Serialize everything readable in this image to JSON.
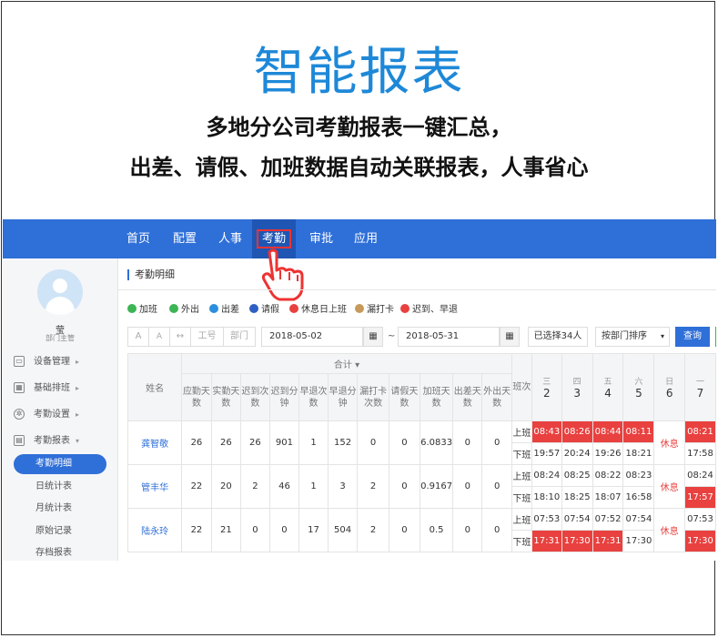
{
  "hero": {
    "title": "智能报表",
    "line1": "多地分公司考勤报表一键汇总，",
    "line2": "出差、请假、加班数据自动关联报表，人事省心"
  },
  "colors": {
    "primary": "#2f6fd8",
    "late": "#e8413f",
    "accent": "#1e88d8"
  },
  "nav": {
    "items": [
      {
        "label": "首页",
        "active": false
      },
      {
        "label": "配置",
        "active": false
      },
      {
        "label": "人事",
        "active": false
      },
      {
        "label": "考勤",
        "active": true
      },
      {
        "label": "审批",
        "active": false
      },
      {
        "label": "应用",
        "active": false
      }
    ]
  },
  "user": {
    "name": "莹",
    "role": "部门主管"
  },
  "sidebar": {
    "menu": [
      {
        "label": "设备管理",
        "icon": "device-icon"
      },
      {
        "label": "基础排班",
        "icon": "calendar-icon"
      },
      {
        "label": "考勤设置",
        "icon": "gear-icon"
      },
      {
        "label": "考勤报表",
        "icon": "report-icon"
      }
    ],
    "submenu": [
      {
        "label": "考勤明细",
        "active": true
      },
      {
        "label": "日统计表",
        "active": false
      },
      {
        "label": "月统计表",
        "active": false
      },
      {
        "label": "原始记录",
        "active": false
      },
      {
        "label": "存档报表",
        "active": false
      }
    ]
  },
  "page": {
    "breadcrumb": "考勤明细",
    "legend": [
      {
        "label": "加班",
        "color": "#3cb554"
      },
      {
        "label": "外出",
        "color": "#3cb554"
      },
      {
        "label": "出差",
        "color": "#2b8fe0"
      },
      {
        "label": "请假",
        "color": "#2f5fc4"
      },
      {
        "label": "休息日上班",
        "color": "#e8413f"
      },
      {
        "label": "漏打卡",
        "color": "#c79a5a"
      },
      {
        "label": "迟到、早退",
        "color": "#e8413f"
      }
    ],
    "toolbar": {
      "font_a1": "A",
      "font_a2": "A",
      "arrows": "↔",
      "employee_no": "工号",
      "department": "部门",
      "start_date": "2018-05-02",
      "tilde": "~",
      "end_date": "2018-05-31",
      "selected": "已选择34人",
      "sort": "按部门排序",
      "query": "查询"
    }
  },
  "table": {
    "name_header": "姓名",
    "total_header": "合计",
    "stat_headers": [
      "应勤天数",
      "实勤天数",
      "迟到次数",
      "迟到分钟",
      "早退次数",
      "早退分钟",
      "漏打卡次数",
      "请假天数",
      "加班天数",
      "出差天数",
      "外出天数"
    ],
    "shift_header": "班次",
    "days": [
      {
        "weekday": "三",
        "day": "2",
        "weekend": false
      },
      {
        "weekday": "四",
        "day": "3",
        "weekend": false
      },
      {
        "weekday": "五",
        "day": "4",
        "weekend": false
      },
      {
        "weekday": "六",
        "day": "5",
        "weekend": true
      },
      {
        "weekday": "日",
        "day": "6",
        "weekend": true
      },
      {
        "weekday": "一",
        "day": "7",
        "weekend": false
      }
    ],
    "shift_on": "上班",
    "shift_off": "下班",
    "rows": [
      {
        "name": "龚智敬",
        "stats": [
          "26",
          "26",
          "26",
          "901",
          "1",
          "152",
          "0",
          "0",
          "6.0833",
          "0",
          "0"
        ],
        "on": [
          {
            "t": "08:43",
            "late": true
          },
          {
            "t": "08:26",
            "late": true
          },
          {
            "t": "08:44",
            "late": true
          },
          {
            "t": "08:11",
            "late": true
          },
          {
            "t": "休息",
            "rest": true
          },
          {
            "t": "08:21",
            "late": true
          }
        ],
        "off": [
          {
            "t": "19:57"
          },
          {
            "t": "20:24"
          },
          {
            "t": "19:26"
          },
          {
            "t": "18:21"
          },
          {
            "t": ""
          },
          {
            "t": "17:58"
          }
        ]
      },
      {
        "name": "管丰华",
        "stats": [
          "22",
          "20",
          "2",
          "46",
          "1",
          "3",
          "2",
          "0",
          "0.9167",
          "0",
          "0"
        ],
        "on": [
          {
            "t": "08:24"
          },
          {
            "t": "08:25"
          },
          {
            "t": "08:22"
          },
          {
            "t": "08:23"
          },
          {
            "t": "休息",
            "rest": true
          },
          {
            "t": "08:24"
          }
        ],
        "off": [
          {
            "t": "18:10"
          },
          {
            "t": "18:25"
          },
          {
            "t": "18:07"
          },
          {
            "t": "16:58"
          },
          {
            "t": ""
          },
          {
            "t": "17:57",
            "late": true
          }
        ]
      },
      {
        "name": "陆永玲",
        "stats": [
          "22",
          "21",
          "0",
          "0",
          "17",
          "504",
          "2",
          "0",
          "0.5",
          "0",
          "0"
        ],
        "on": [
          {
            "t": "07:53"
          },
          {
            "t": "07:54"
          },
          {
            "t": "07:52"
          },
          {
            "t": "07:54"
          },
          {
            "t": "休息",
            "rest": true
          },
          {
            "t": "07:53"
          }
        ],
        "off": [
          {
            "t": "17:31",
            "late": true
          },
          {
            "t": "17:30",
            "late": true
          },
          {
            "t": "17:31",
            "late": true
          },
          {
            "t": "17:30"
          },
          {
            "t": ""
          },
          {
            "t": "17:30",
            "late": true
          }
        ]
      }
    ]
  }
}
